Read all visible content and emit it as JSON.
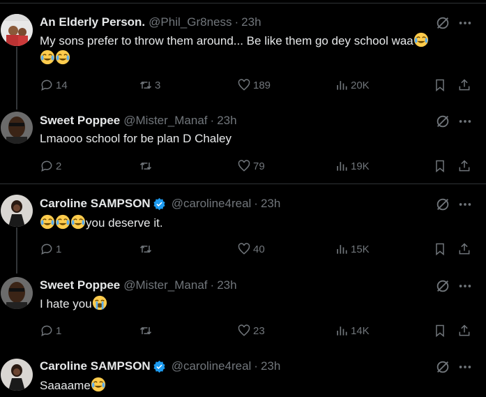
{
  "tweets": [
    {
      "name": "An Elderly Person.",
      "handle": "@Phil_Gr8ness",
      "time": "23h",
      "text": "My sons prefer to throw them around... Be like them go dey school waa",
      "emojis": [
        "joy",
        "joy",
        "joy"
      ],
      "replies": "14",
      "retweets": "3",
      "likes": "189",
      "views": "20K",
      "verified": false
    },
    {
      "name": "Sweet Poppee",
      "handle": "@Mister_Manaf",
      "time": "23h",
      "text": "Lmaooo school for be plan D Chaley",
      "emojis": [],
      "replies": "2",
      "retweets": "",
      "likes": "79",
      "views": "19K",
      "verified": false
    },
    {
      "name": "Caroline SAMPSON",
      "handle": "@caroline4real",
      "time": "23h",
      "text": "you deserve it.",
      "emojis": [
        "joy",
        "joy",
        "joy"
      ],
      "replies": "1",
      "retweets": "",
      "likes": "40",
      "views": "15K",
      "verified": true
    },
    {
      "name": "Sweet Poppee",
      "handle": "@Mister_Manaf",
      "time": "23h",
      "text": "I hate you",
      "emojis": [
        "sob"
      ],
      "replies": "1",
      "retweets": "",
      "likes": "23",
      "views": "14K",
      "verified": false
    },
    {
      "name": "Caroline SAMPSON",
      "handle": "@caroline4real",
      "time": "23h",
      "text": "Saaaame",
      "emojis": [
        "joy"
      ],
      "verified": true
    }
  ],
  "separator": "·",
  "icons": {
    "reply": "reply-icon",
    "retweet": "retweet-icon",
    "like": "heart-icon",
    "views": "views-chart-icon",
    "bookmark": "bookmark-icon",
    "share": "share-icon",
    "grok": "grok-icon",
    "more": "more-icon",
    "verified": "verified-badge-icon"
  },
  "colors": {
    "background": "#000000",
    "text": "#e7e9ea",
    "muted": "#71767b",
    "verified": "#1d9bf0",
    "divider": "#2f3336"
  }
}
